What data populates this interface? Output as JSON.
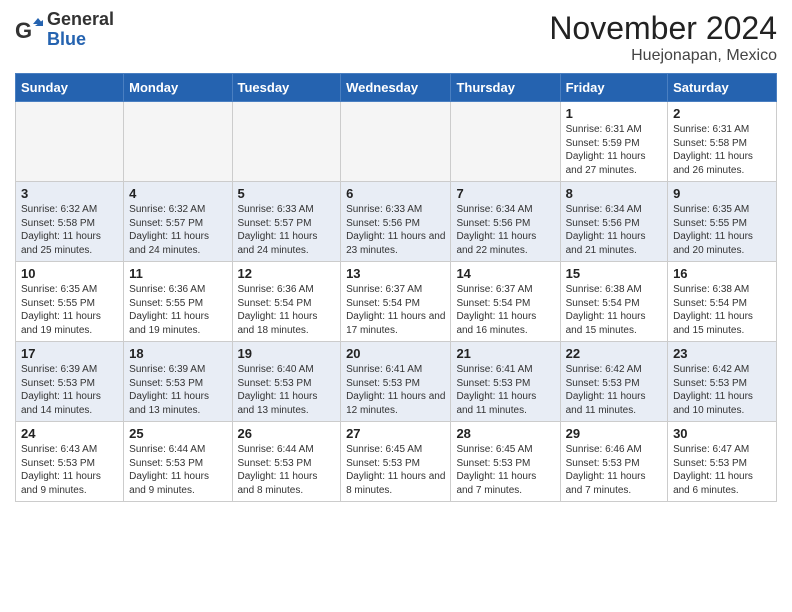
{
  "header": {
    "logo_general": "General",
    "logo_blue": "Blue",
    "month_title": "November 2024",
    "location": "Huejonapan, Mexico"
  },
  "weekdays": [
    "Sunday",
    "Monday",
    "Tuesday",
    "Wednesday",
    "Thursday",
    "Friday",
    "Saturday"
  ],
  "weeks": [
    [
      {
        "day": "",
        "sunrise": "",
        "sunset": "",
        "daylight": "",
        "empty": true
      },
      {
        "day": "",
        "sunrise": "",
        "sunset": "",
        "daylight": "",
        "empty": true
      },
      {
        "day": "",
        "sunrise": "",
        "sunset": "",
        "daylight": "",
        "empty": true
      },
      {
        "day": "",
        "sunrise": "",
        "sunset": "",
        "daylight": "",
        "empty": true
      },
      {
        "day": "",
        "sunrise": "",
        "sunset": "",
        "daylight": "",
        "empty": true
      },
      {
        "day": "1",
        "sunrise": "Sunrise: 6:31 AM",
        "sunset": "Sunset: 5:59 PM",
        "daylight": "Daylight: 11 hours and 27 minutes.",
        "empty": false
      },
      {
        "day": "2",
        "sunrise": "Sunrise: 6:31 AM",
        "sunset": "Sunset: 5:58 PM",
        "daylight": "Daylight: 11 hours and 26 minutes.",
        "empty": false
      }
    ],
    [
      {
        "day": "3",
        "sunrise": "Sunrise: 6:32 AM",
        "sunset": "Sunset: 5:58 PM",
        "daylight": "Daylight: 11 hours and 25 minutes.",
        "empty": false
      },
      {
        "day": "4",
        "sunrise": "Sunrise: 6:32 AM",
        "sunset": "Sunset: 5:57 PM",
        "daylight": "Daylight: 11 hours and 24 minutes.",
        "empty": false
      },
      {
        "day": "5",
        "sunrise": "Sunrise: 6:33 AM",
        "sunset": "Sunset: 5:57 PM",
        "daylight": "Daylight: 11 hours and 24 minutes.",
        "empty": false
      },
      {
        "day": "6",
        "sunrise": "Sunrise: 6:33 AM",
        "sunset": "Sunset: 5:56 PM",
        "daylight": "Daylight: 11 hours and 23 minutes.",
        "empty": false
      },
      {
        "day": "7",
        "sunrise": "Sunrise: 6:34 AM",
        "sunset": "Sunset: 5:56 PM",
        "daylight": "Daylight: 11 hours and 22 minutes.",
        "empty": false
      },
      {
        "day": "8",
        "sunrise": "Sunrise: 6:34 AM",
        "sunset": "Sunset: 5:56 PM",
        "daylight": "Daylight: 11 hours and 21 minutes.",
        "empty": false
      },
      {
        "day": "9",
        "sunrise": "Sunrise: 6:35 AM",
        "sunset": "Sunset: 5:55 PM",
        "daylight": "Daylight: 11 hours and 20 minutes.",
        "empty": false
      }
    ],
    [
      {
        "day": "10",
        "sunrise": "Sunrise: 6:35 AM",
        "sunset": "Sunset: 5:55 PM",
        "daylight": "Daylight: 11 hours and 19 minutes.",
        "empty": false
      },
      {
        "day": "11",
        "sunrise": "Sunrise: 6:36 AM",
        "sunset": "Sunset: 5:55 PM",
        "daylight": "Daylight: 11 hours and 19 minutes.",
        "empty": false
      },
      {
        "day": "12",
        "sunrise": "Sunrise: 6:36 AM",
        "sunset": "Sunset: 5:54 PM",
        "daylight": "Daylight: 11 hours and 18 minutes.",
        "empty": false
      },
      {
        "day": "13",
        "sunrise": "Sunrise: 6:37 AM",
        "sunset": "Sunset: 5:54 PM",
        "daylight": "Daylight: 11 hours and 17 minutes.",
        "empty": false
      },
      {
        "day": "14",
        "sunrise": "Sunrise: 6:37 AM",
        "sunset": "Sunset: 5:54 PM",
        "daylight": "Daylight: 11 hours and 16 minutes.",
        "empty": false
      },
      {
        "day": "15",
        "sunrise": "Sunrise: 6:38 AM",
        "sunset": "Sunset: 5:54 PM",
        "daylight": "Daylight: 11 hours and 15 minutes.",
        "empty": false
      },
      {
        "day": "16",
        "sunrise": "Sunrise: 6:38 AM",
        "sunset": "Sunset: 5:54 PM",
        "daylight": "Daylight: 11 hours and 15 minutes.",
        "empty": false
      }
    ],
    [
      {
        "day": "17",
        "sunrise": "Sunrise: 6:39 AM",
        "sunset": "Sunset: 5:53 PM",
        "daylight": "Daylight: 11 hours and 14 minutes.",
        "empty": false
      },
      {
        "day": "18",
        "sunrise": "Sunrise: 6:39 AM",
        "sunset": "Sunset: 5:53 PM",
        "daylight": "Daylight: 11 hours and 13 minutes.",
        "empty": false
      },
      {
        "day": "19",
        "sunrise": "Sunrise: 6:40 AM",
        "sunset": "Sunset: 5:53 PM",
        "daylight": "Daylight: 11 hours and 13 minutes.",
        "empty": false
      },
      {
        "day": "20",
        "sunrise": "Sunrise: 6:41 AM",
        "sunset": "Sunset: 5:53 PM",
        "daylight": "Daylight: 11 hours and 12 minutes.",
        "empty": false
      },
      {
        "day": "21",
        "sunrise": "Sunrise: 6:41 AM",
        "sunset": "Sunset: 5:53 PM",
        "daylight": "Daylight: 11 hours and 11 minutes.",
        "empty": false
      },
      {
        "day": "22",
        "sunrise": "Sunrise: 6:42 AM",
        "sunset": "Sunset: 5:53 PM",
        "daylight": "Daylight: 11 hours and 11 minutes.",
        "empty": false
      },
      {
        "day": "23",
        "sunrise": "Sunrise: 6:42 AM",
        "sunset": "Sunset: 5:53 PM",
        "daylight": "Daylight: 11 hours and 10 minutes.",
        "empty": false
      }
    ],
    [
      {
        "day": "24",
        "sunrise": "Sunrise: 6:43 AM",
        "sunset": "Sunset: 5:53 PM",
        "daylight": "Daylight: 11 hours and 9 minutes.",
        "empty": false
      },
      {
        "day": "25",
        "sunrise": "Sunrise: 6:44 AM",
        "sunset": "Sunset: 5:53 PM",
        "daylight": "Daylight: 11 hours and 9 minutes.",
        "empty": false
      },
      {
        "day": "26",
        "sunrise": "Sunrise: 6:44 AM",
        "sunset": "Sunset: 5:53 PM",
        "daylight": "Daylight: 11 hours and 8 minutes.",
        "empty": false
      },
      {
        "day": "27",
        "sunrise": "Sunrise: 6:45 AM",
        "sunset": "Sunset: 5:53 PM",
        "daylight": "Daylight: 11 hours and 8 minutes.",
        "empty": false
      },
      {
        "day": "28",
        "sunrise": "Sunrise: 6:45 AM",
        "sunset": "Sunset: 5:53 PM",
        "daylight": "Daylight: 11 hours and 7 minutes.",
        "empty": false
      },
      {
        "day": "29",
        "sunrise": "Sunrise: 6:46 AM",
        "sunset": "Sunset: 5:53 PM",
        "daylight": "Daylight: 11 hours and 7 minutes.",
        "empty": false
      },
      {
        "day": "30",
        "sunrise": "Sunrise: 6:47 AM",
        "sunset": "Sunset: 5:53 PM",
        "daylight": "Daylight: 11 hours and 6 minutes.",
        "empty": false
      }
    ]
  ]
}
